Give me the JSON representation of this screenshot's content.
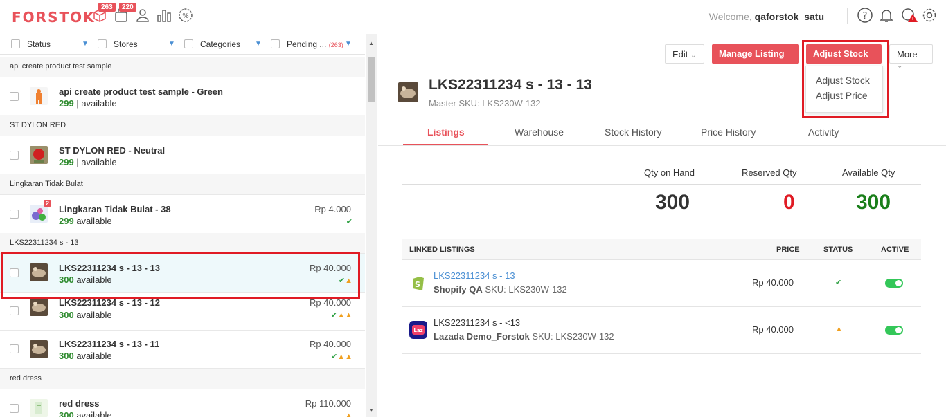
{
  "header": {
    "logo": "FORSTOK",
    "badge_orders": "263",
    "badge_items": "220",
    "welcome_prefix": "Welcome,",
    "username": "qaforstok_satu"
  },
  "filters": {
    "status": "Status",
    "stores": "Stores",
    "categories": "Categories",
    "pending": "Pending ...",
    "pending_count": "(263)"
  },
  "list": {
    "groups": [
      "api create product test sample",
      "ST DYLON RED",
      "Lingkaran Tidak Bulat",
      "LKS22311234 s - 13",
      "red dress"
    ],
    "items": [
      {
        "name": "api create product test sample - Green",
        "qty": "299",
        "avail": "| available",
        "price": ""
      },
      {
        "name": "ST DYLON RED - Neutral",
        "qty": "299",
        "avail": "| available",
        "price": ""
      },
      {
        "name": "Lingkaran Tidak Bulat - 38",
        "qty": "299",
        "avail": "available",
        "price": "Rp 4.000",
        "thumb_badge": "2"
      },
      {
        "name": "LKS22311234 s - 13 - 13",
        "qty": "300",
        "avail": "available",
        "price": "Rp 40.000"
      },
      {
        "name": "LKS22311234 s - 13 - 12",
        "qty": "300",
        "avail": "available",
        "price": "Rp 40.000"
      },
      {
        "name": "LKS22311234 s - 13 - 11",
        "qty": "300",
        "avail": "available",
        "price": "Rp 40.000"
      },
      {
        "name": "red dress",
        "qty": "300",
        "avail": "available",
        "price": "Rp 110.000"
      }
    ]
  },
  "actions": {
    "edit": "Edit",
    "manage_listing": "Manage Listing",
    "adjust_stock": "Adjust Stock",
    "more": "More",
    "menu_adjust_stock": "Adjust Stock",
    "menu_adjust_price": "Adjust Price"
  },
  "detail": {
    "title": "LKS22311234 s - 13 - 13",
    "master_sku": "Master SKU: LKS230W-132"
  },
  "tabs": [
    "Listings",
    "Warehouse",
    "Stock History",
    "Price History",
    "Activity"
  ],
  "qty": {
    "on_hand_label": "Qty on Hand",
    "reserved_label": "Reserved Qty",
    "available_label": "Available Qty",
    "on_hand": "300",
    "reserved": "0",
    "available": "300"
  },
  "linked": {
    "header": "LINKED LISTINGS",
    "price_col": "PRICE",
    "status_col": "STATUS",
    "active_col": "ACTIVE",
    "rows": [
      {
        "name": "LKS22311234 s - 13",
        "store": "Shopify QA",
        "sku": "SKU: LKS230W-132",
        "price": "Rp  40.000",
        "logo": "shopify-logo"
      },
      {
        "name": "LKS22311234 s - <13",
        "store": "Lazada Demo_Forstok",
        "sku": "SKU: LKS230W-132",
        "price": "Rp  40.000",
        "logo": "lazada-logo",
        "logo_text": "Laz"
      }
    ]
  },
  "colors": {
    "accent": "#e8525a",
    "success": "#2e8b2e",
    "warning": "#f0a020",
    "link": "#4a8fd3"
  }
}
